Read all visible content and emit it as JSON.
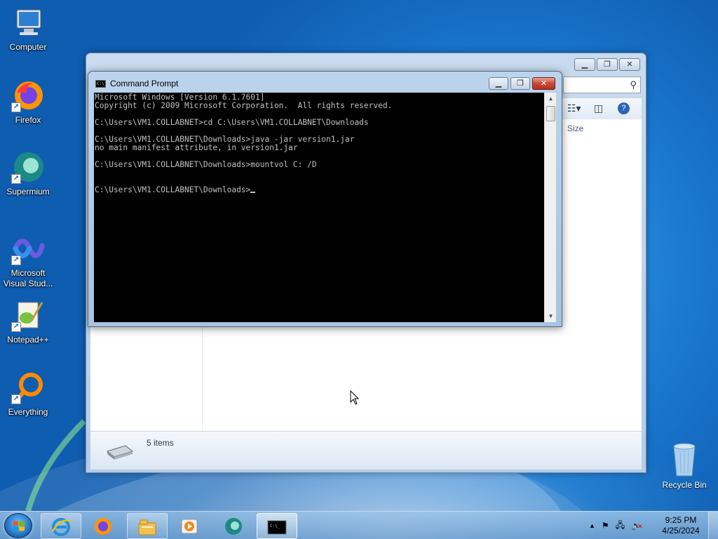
{
  "desktop": {
    "icons": [
      {
        "label": "Computer",
        "icon": "computer-icon"
      },
      {
        "label": "Firefox",
        "icon": "firefox-icon"
      },
      {
        "label": "Supermium",
        "icon": "supermium-icon"
      },
      {
        "label": "Microsoft Visual Stud...",
        "icon": "visual-studio-icon"
      },
      {
        "label": "Notepad++",
        "icon": "notepad-plus-plus-icon"
      },
      {
        "label": "Everything",
        "icon": "everything-icon"
      }
    ],
    "recycle_bin": {
      "label": "Recycle Bin",
      "icon": "recycle-bin-icon"
    }
  },
  "explorer": {
    "column_header": "Size",
    "status_count": "5 items"
  },
  "cmd": {
    "title": "Command Prompt",
    "lines": [
      "Microsoft Windows [Version 6.1.7601]",
      "Copyright (c) 2009 Microsoft Corporation.  All rights reserved.",
      "",
      "C:\\Users\\VM1.COLLABNET>cd C:\\Users\\VM1.COLLABNET\\Downloads",
      "",
      "C:\\Users\\VM1.COLLABNET\\Downloads>java -jar version1.jar",
      "no main manifest attribute, in version1.jar",
      "",
      "C:\\Users\\VM1.COLLABNET\\Downloads>mountvol C: /D",
      "",
      ""
    ],
    "prompt": "C:\\Users\\VM1.COLLABNET\\Downloads>"
  },
  "taskbar": {
    "items": [
      "internet-explorer-icon",
      "firefox-icon",
      "file-explorer-icon",
      "media-player-icon",
      "supermium-icon",
      "command-prompt-icon"
    ],
    "active_item": "command-prompt-icon",
    "clock_time": "9:25 PM",
    "clock_date": "4/25/2024"
  },
  "colors": {
    "console_bg": "#000000",
    "console_text": "#c0c0c0",
    "desktop_blue": "#1a78cf"
  }
}
